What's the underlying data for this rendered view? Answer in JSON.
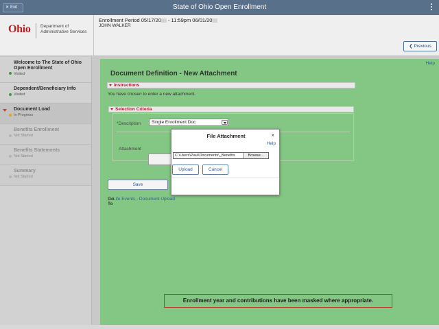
{
  "topbar": {
    "exit_label": "Exit",
    "app_title": "State of Ohio Open Enrollment"
  },
  "header": {
    "logo_word": "Ohio",
    "logo_dept_line1": "Department of",
    "logo_dept_line2": "Administrative Services",
    "enroll_period_a": "Enrollment Period 05/17/20",
    "enroll_period_b": " - 11:59pm 06/01/20",
    "user_name": "JOHN WALKER",
    "previous_label": "Previous"
  },
  "sidebar": {
    "items": [
      {
        "title": "Welcome to The State of Ohio Open Enrollment",
        "status": "Visited",
        "state": "visited"
      },
      {
        "title": "Dependent/Beneficiary Info",
        "status": "Visited",
        "state": "visited"
      },
      {
        "title": "Document Load",
        "status": "In Progress",
        "state": "current"
      },
      {
        "title": "Benefits Enrollment",
        "status": "Not Started",
        "state": "not-started"
      },
      {
        "title": "Benefits Statements",
        "status": "Not Started",
        "state": "not-started"
      },
      {
        "title": "Summary",
        "status": "Not Started",
        "state": "not-started"
      }
    ]
  },
  "main": {
    "help_label": "Help",
    "page_title": "Document Definition - New Attachment",
    "instructions_header": "Instructions",
    "instructions_text": "You have chosen to enter a new attachment.",
    "criteria_header": "Selection Criteria",
    "description_label": "*Description",
    "description_value": "Single Enrollment Doc",
    "attachment_label": "Attachment",
    "save_label": "Save",
    "goto_label": "Go To",
    "goto_link": "Life Events - Document Upload",
    "mask_note": "Enrollment year and contributions have been masked where appropriate."
  },
  "modal": {
    "title": "File Attachment",
    "close_glyph": "×",
    "help_label": "Help",
    "file_path": "C:\\Users\\Paul\\Documents\\_Benefits",
    "browse_label": "Browse...",
    "upload_label": "Upload",
    "cancel_label": "Cancel"
  },
  "colors": {
    "topbar": "#58708a",
    "main_bg": "#84c784",
    "section_title": "#b01c2e",
    "link": "#2a5f9e",
    "logo_red": "#b52026"
  }
}
